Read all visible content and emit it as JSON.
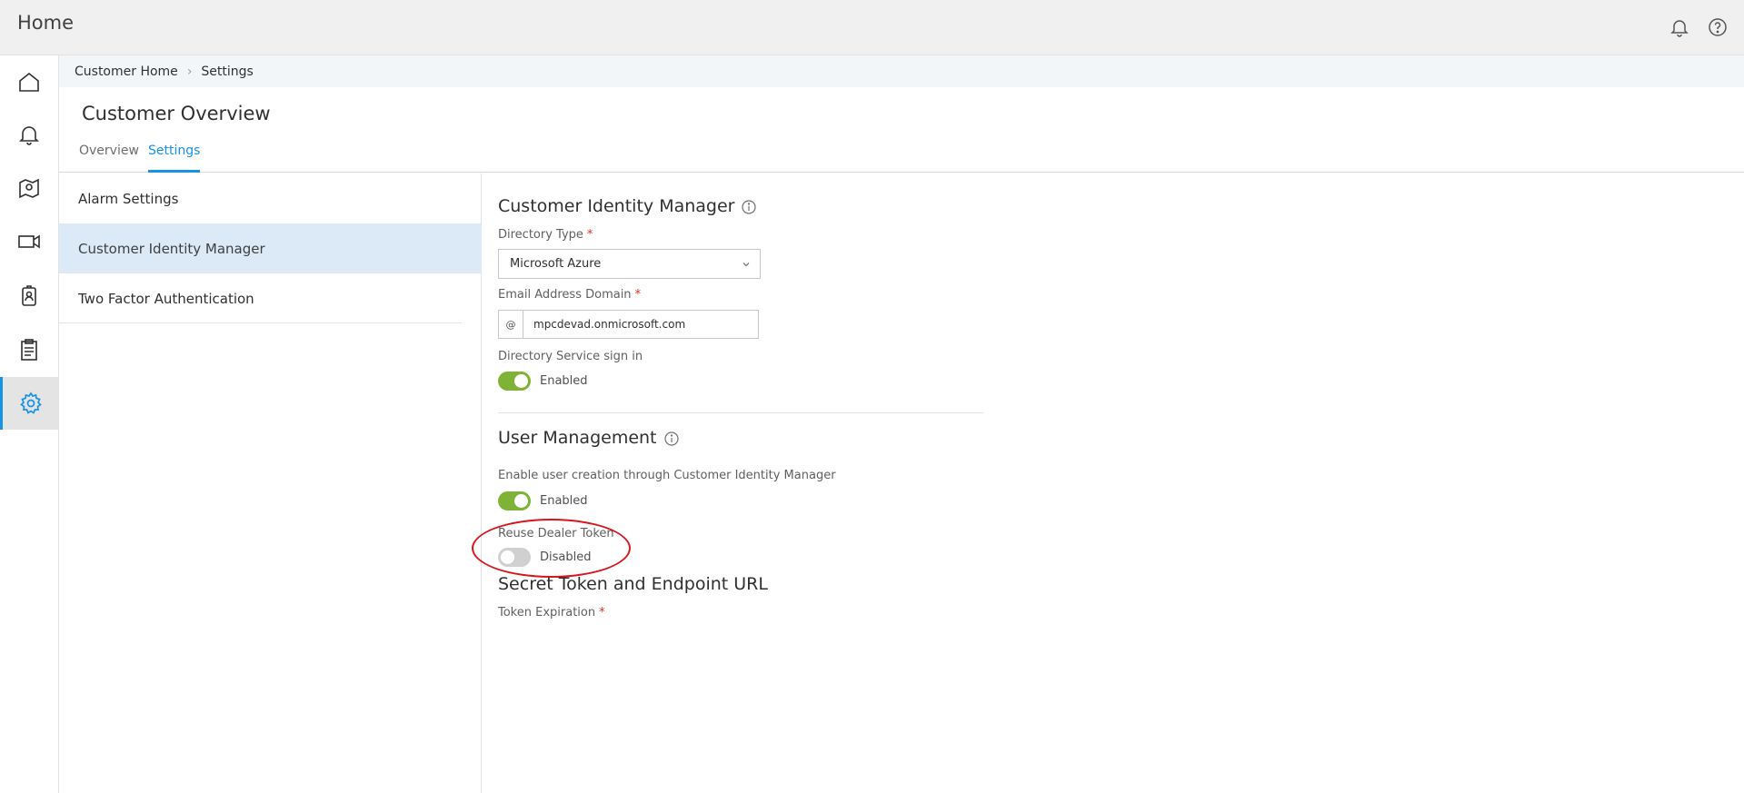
{
  "header": {
    "title": "Home"
  },
  "top_icons": [
    "bell-icon",
    "help-icon"
  ],
  "rail": {
    "items": [
      {
        "name": "home-icon"
      },
      {
        "name": "bell-icon"
      },
      {
        "name": "map-pin-icon"
      },
      {
        "name": "video-camera-icon"
      },
      {
        "name": "badge-icon"
      },
      {
        "name": "clipboard-icon"
      },
      {
        "name": "gear-icon",
        "active": true
      }
    ]
  },
  "breadcrumb": {
    "items": [
      "Customer Home",
      "Settings"
    ]
  },
  "page": {
    "title": "Customer Overview",
    "tabs": [
      {
        "label": "Overview"
      },
      {
        "label": "Settings",
        "active": true
      }
    ]
  },
  "settings_menu": {
    "items": [
      {
        "label": "Alarm Settings"
      },
      {
        "label": "Customer Identity Manager",
        "selected": true
      },
      {
        "label": "Two Factor Authentication"
      }
    ]
  },
  "identity_manager": {
    "title": "Customer Identity Manager",
    "directory_type": {
      "label": "Directory Type",
      "required_mark": "*",
      "value": "Microsoft Azure"
    },
    "email_domain": {
      "label": "Email Address Domain",
      "required_mark": "*",
      "prefix_symbol": "@",
      "value": "mpcdevad.onmicrosoft.com"
    },
    "directory_signin": {
      "label": "Directory Service sign in",
      "status": "Enabled",
      "on": true
    }
  },
  "user_management": {
    "title": "User Management",
    "enable_creation": {
      "label": "Enable user creation through Customer Identity Manager",
      "status": "Enabled",
      "on": true
    },
    "reuse_dealer_token": {
      "label": "Reuse Dealer Token",
      "status": "Disabled",
      "on": false
    }
  },
  "secret_token": {
    "title": "Secret Token and Endpoint URL",
    "token_expiration": {
      "label": "Token Expiration",
      "required_mark": "*"
    }
  },
  "colors": {
    "accent": "#1792e5",
    "toggle_on": "#7eb338",
    "toggle_off": "#d0d0d0",
    "selected_row": "#dbeaf6",
    "required": "#e0301e",
    "annotation": "#d9141c"
  }
}
